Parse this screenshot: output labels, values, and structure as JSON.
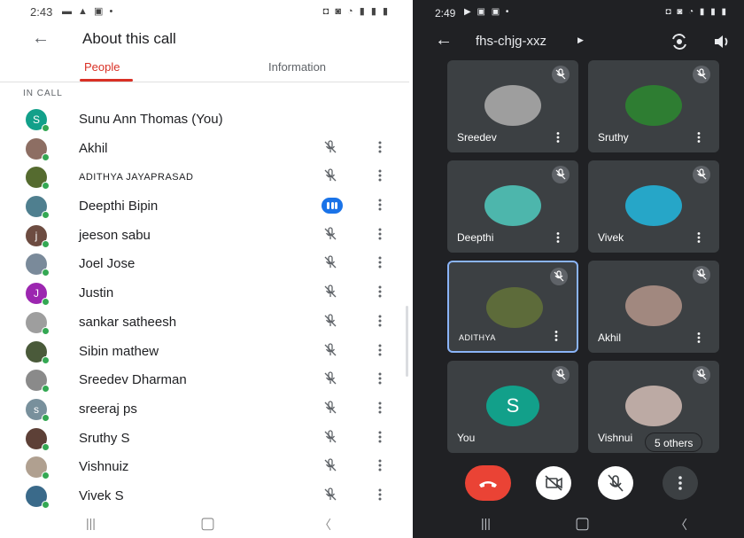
{
  "left_screen": {
    "status_time": "2:43",
    "header_title": "About this call",
    "tabs": [
      {
        "label": "People",
        "selected": true
      },
      {
        "label": "Information",
        "selected": false
      }
    ],
    "section_label": "IN CALL",
    "participants": [
      {
        "name": "Sunu Ann Thomas (You)",
        "initial": "S",
        "avatar_color": "#12a08a",
        "mic": "none",
        "has_menu": false
      },
      {
        "name": "Akhil",
        "initial": "",
        "avatar_color": "#8d6e63",
        "mic": "muted",
        "has_menu": true
      },
      {
        "name": "ADITHYA JAYAPRASAD",
        "initial": "",
        "avatar_color": "#556b2f",
        "mic": "muted",
        "has_menu": true
      },
      {
        "name": "Deepthi Bipin",
        "initial": "",
        "avatar_color": "#4f7f8f",
        "mic": "speaking",
        "has_menu": true
      },
      {
        "name": "jeeson sabu",
        "initial": "j",
        "avatar_color": "#6d4c41",
        "mic": "muted",
        "has_menu": true
      },
      {
        "name": "Joel Jose",
        "initial": "",
        "avatar_color": "#7a8a9a",
        "mic": "muted",
        "has_menu": true
      },
      {
        "name": "Justin",
        "initial": "J",
        "avatar_color": "#9c27b0",
        "mic": "muted",
        "has_menu": true
      },
      {
        "name": "sankar satheesh",
        "initial": "",
        "avatar_color": "#9e9e9e",
        "mic": "muted",
        "has_menu": true
      },
      {
        "name": "Sibin mathew",
        "initial": "",
        "avatar_color": "#4a5a3a",
        "mic": "muted",
        "has_menu": true
      },
      {
        "name": "Sreedev Dharman",
        "initial": "",
        "avatar_color": "#8a8a8a",
        "mic": "muted",
        "has_menu": true
      },
      {
        "name": "sreeraj ps",
        "initial": "s",
        "avatar_color": "#78909c",
        "mic": "muted",
        "has_menu": true
      },
      {
        "name": "Sruthy S",
        "initial": "",
        "avatar_color": "#5d4037",
        "mic": "muted",
        "has_menu": true
      },
      {
        "name": "Vishnuiz",
        "initial": "",
        "avatar_color": "#b0a090",
        "mic": "muted",
        "has_menu": true
      },
      {
        "name": "Vivek S",
        "initial": "",
        "avatar_color": "#3a6a8a",
        "mic": "muted",
        "has_menu": true
      }
    ]
  },
  "right_screen": {
    "status_time": "2:49",
    "meeting_code": "fhs-chjg-xxz",
    "tiles": [
      {
        "name": "Sreedev",
        "avatar_color": "#9e9e9e",
        "kind": "photo"
      },
      {
        "name": "Sruthy",
        "avatar_color": "#2e7d32",
        "kind": "photo"
      },
      {
        "name": "Deepthi",
        "avatar_color": "#4db6ac",
        "kind": "photo"
      },
      {
        "name": "Vivek",
        "avatar_color": "#26a6c8",
        "kind": "photo"
      },
      {
        "name": "ADITHYA",
        "avatar_color": "#5d6b3a",
        "kind": "photo",
        "active": true
      },
      {
        "name": "Akhil",
        "avatar_color": "#a1887f",
        "kind": "photo"
      },
      {
        "name": "You",
        "avatar_color": "#12a08a",
        "kind": "initial",
        "initial": "S"
      },
      {
        "name": "Vishnui",
        "avatar_color": "#bcaaa4",
        "kind": "photo"
      }
    ],
    "others_label": "5 others",
    "colors": {
      "end_call": "#ea4335",
      "tile_bg": "#3c4043",
      "active_border": "#8ab4f8"
    }
  }
}
